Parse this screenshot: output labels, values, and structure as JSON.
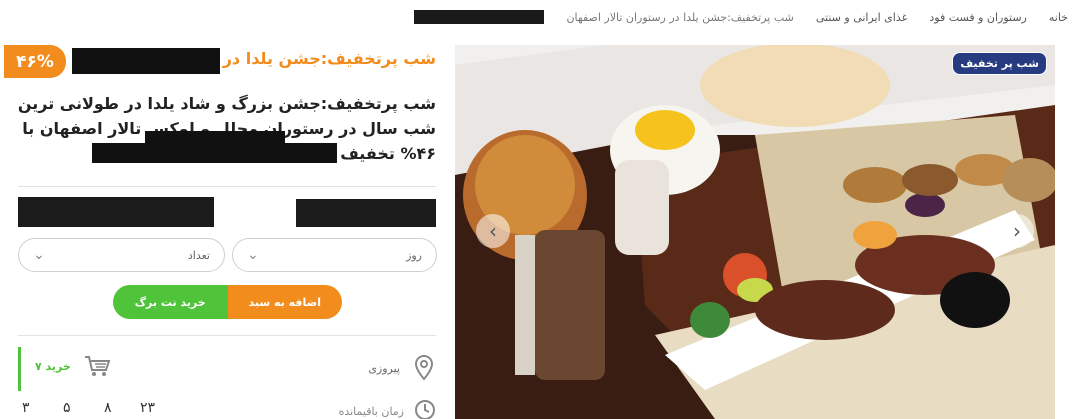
{
  "breadcrumb": {
    "home": "خانه",
    "restaurant": "رستوران و فست فود",
    "iranian_food": "غذای ایرانی و سنتی",
    "current": "شب پرتخفیف:جشن یلدا در رستوران تالار اصفهان"
  },
  "deal": {
    "discount_badge": "۴۶%",
    "title": "شب پرتخفیف:جشن یلدا در رستوران تالار اصفهان",
    "description": "شب پرتخفیف:جشن بزرگ و شاد یلدا در طولانی ترین شب سال در رستوران مجلل و لوکس تالار اصفهان با ۴۶% تخفیف و پرداخت تنها ۵۴ درصد"
  },
  "selects": {
    "day": "روز",
    "count": "تعداد"
  },
  "buttons": {
    "add_to_cart": "اضافه به سبد",
    "buy_netbarg": "خرید نت برگ"
  },
  "info": {
    "location": "پیروزی",
    "sold": "۷ خرید"
  },
  "timer": {
    "label": "زمان باقیمانده",
    "days": "۲۳",
    "hours": "۸",
    "minutes": "۵",
    "seconds": "۳"
  },
  "image": {
    "badge": "شب پر تخفیف"
  },
  "colors": {
    "accent_orange": "#f28c1c",
    "accent_green": "#4fc43a",
    "badge_blue": "#263b80"
  },
  "icons": [
    "location-pin-icon",
    "cart-icon",
    "clock-icon",
    "chevron-down-icon",
    "chevron-left-icon",
    "chevron-right-icon"
  ]
}
